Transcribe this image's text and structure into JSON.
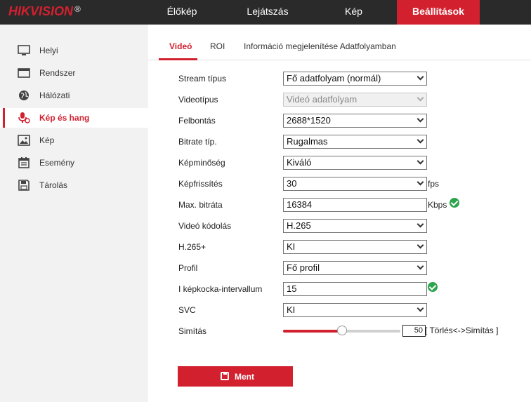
{
  "brand": {
    "name": "HIKVISION",
    "reg": "®"
  },
  "nav": [
    {
      "label": "Élőkép"
    },
    {
      "label": "Lejátszás"
    },
    {
      "label": "Kép"
    },
    {
      "label": "Beállítások",
      "active": true
    }
  ],
  "sidebar": {
    "items": [
      {
        "label": "Helyi",
        "icon": "monitor-icon"
      },
      {
        "label": "Rendszer",
        "icon": "system-icon"
      },
      {
        "label": "Hálózati",
        "icon": "globe-icon"
      },
      {
        "label": "Kép és hang",
        "icon": "video-audio-icon",
        "active": true
      },
      {
        "label": "Kép",
        "icon": "image-icon"
      },
      {
        "label": "Esemény",
        "icon": "calendar-icon"
      },
      {
        "label": "Tárolás",
        "icon": "storage-icon"
      }
    ]
  },
  "tabs": [
    {
      "label": "Videó",
      "active": true
    },
    {
      "label": "ROI"
    },
    {
      "label": "Információ megjelenítése Adatfolyamban"
    }
  ],
  "form": {
    "stream_type": {
      "label": "Stream típus",
      "value": "Fő adatfolyam (normál)"
    },
    "video_type": {
      "label": "Videotípus",
      "value": "Videó adatfolyam"
    },
    "resolution": {
      "label": "Felbontás",
      "value": "2688*1520"
    },
    "bitrate_type": {
      "label": "Bitrate típ.",
      "value": "Rugalmas"
    },
    "quality": {
      "label": "Képminőség",
      "value": "Kiváló"
    },
    "frame_rate": {
      "label": "Képfrissítés",
      "value": "30",
      "unit": "fps"
    },
    "max_bitrate": {
      "label": "Max. bitráta",
      "value": "16384",
      "unit": "Kbps"
    },
    "encoding": {
      "label": "Videó kódolás",
      "value": "H.265"
    },
    "h265plus": {
      "label": "H.265+",
      "value": "KI"
    },
    "profile": {
      "label": "Profil",
      "value": "Fő profil"
    },
    "iframe": {
      "label": "I képkocka-intervallum",
      "value": "15"
    },
    "svc": {
      "label": "SVC",
      "value": "KI"
    },
    "smoothing": {
      "label": "Simítás",
      "value": "50",
      "level": 0.5,
      "hint": "[ Törlés<->Simítás ]"
    }
  },
  "save_label": "Ment",
  "colors": {
    "accent": "#d2202f",
    "topbar": "#2a2a2a",
    "ok": "#2da44e"
  }
}
